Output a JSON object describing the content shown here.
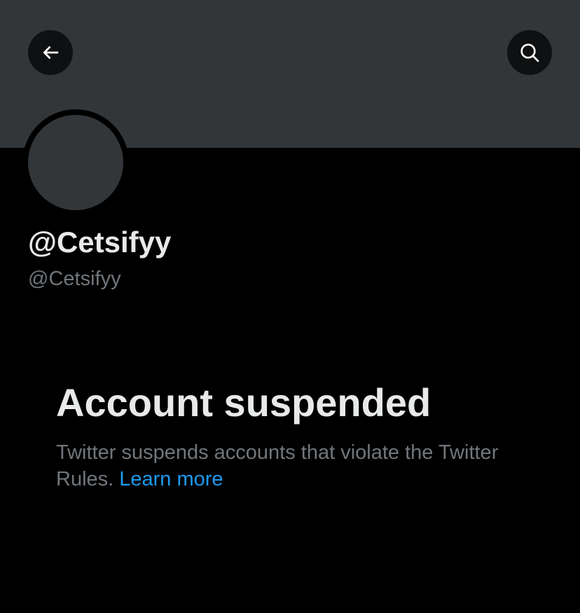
{
  "profile": {
    "display_name": "@Cetsifyy",
    "handle": "@Cetsifyy"
  },
  "notice": {
    "title": "Account suspended",
    "description": "Twitter suspends accounts that violate the Twitter Rules.",
    "link_label": "Learn more"
  },
  "icons": {
    "back": "arrow-left-icon",
    "search": "search-icon"
  },
  "colors": {
    "banner": "#333639",
    "background": "#000000",
    "primary_text": "#e7e9ea",
    "secondary_text": "#71767b",
    "link": "#1d9bf0",
    "icon_button_bg": "#0f1011"
  }
}
